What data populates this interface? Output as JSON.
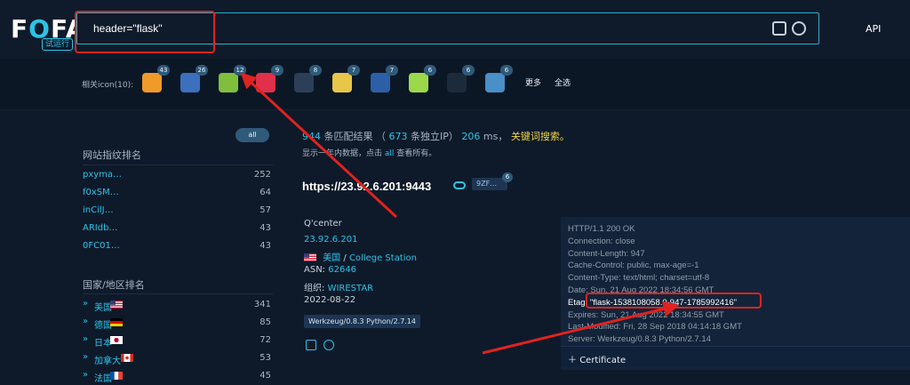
{
  "header": {
    "logo_text": "FOFA",
    "logo_badge": "试运行",
    "search_value": "header=\"flask\"",
    "api_label": "API"
  },
  "icon_bar": {
    "label": "相关icon(10):",
    "icons": [
      {
        "name": "icon-1",
        "count": "43",
        "color": "#f09a29"
      },
      {
        "name": "icon-2",
        "count": "26",
        "color": "#3d6fbf"
      },
      {
        "name": "icon-3",
        "count": "12",
        "color": "#7fbf3d"
      },
      {
        "name": "icon-4",
        "count": "9",
        "color": "#e0304a"
      },
      {
        "name": "icon-5",
        "count": "8",
        "color": "#2c3e58"
      },
      {
        "name": "icon-6",
        "count": "7",
        "color": "#e8c64a"
      },
      {
        "name": "icon-7",
        "count": "7",
        "color": "#2c5fa8"
      },
      {
        "name": "icon-8",
        "count": "6",
        "color": "#9bd84a"
      },
      {
        "name": "icon-9",
        "count": "6",
        "color": "#1b2b3c"
      },
      {
        "name": "icon-10",
        "count": "6",
        "color": "#4a8fc7"
      }
    ],
    "more_label": "更多",
    "select_all_label": "全选"
  },
  "fingerprint": {
    "title": "网站指纹排名",
    "all_label": "all",
    "items": [
      {
        "name": "pxyma…",
        "count": "252"
      },
      {
        "name": "f0xSM…",
        "count": "64"
      },
      {
        "name": "inCilJ…",
        "count": "57"
      },
      {
        "name": "ARIdb…",
        "count": "43"
      },
      {
        "name": "0FC01…",
        "count": "43"
      }
    ]
  },
  "countries": {
    "title": "国家/地区排名",
    "items": [
      {
        "name": "美国",
        "count": "341",
        "flag": "us"
      },
      {
        "name": "德国",
        "count": "85",
        "flag": "de"
      },
      {
        "name": "日本",
        "count": "72",
        "flag": "jp"
      },
      {
        "name": "加拿大",
        "count": "53",
        "flag": "ca"
      },
      {
        "name": "法国",
        "count": "45",
        "flag": "fr"
      }
    ]
  },
  "summary": {
    "total": "944",
    "total_suffix": "条匹配结果",
    "paren_open": "（",
    "unique_ip": "673",
    "unique_ip_suffix": "条独立IP）",
    "ms_value": "206",
    "ms_suffix": "ms，",
    "keyword_label": "关键词搜索。",
    "line2_prefix": "显示一年内数据，点击",
    "line2_all": "all",
    "line2_suffix": "查看所有。"
  },
  "result": {
    "host": "https://23.92.6.201:9443",
    "tag": "9ZF…",
    "tag_count": "6",
    "title": "Q'center",
    "ip": "23.92.6.201",
    "country": "美国",
    "separator": "/",
    "city": "College Station",
    "asn_label": "ASN:",
    "asn_value": "62646",
    "org_label": "组织:",
    "org_value": "WIRESTAR",
    "date": "2022-08-22",
    "server_tag": "Werkzeug/0.8.3 Python/2.7.14"
  },
  "response_headers": [
    "HTTP/1.1 200 OK",
    "Connection: close",
    "Content-Length: 947",
    "Cache-Control: public, max-age=-1",
    "Content-Type: text/html; charset=utf-8",
    "Date: Sun, 21 Aug 2022 18:34:56 GMT",
    "Etag: \"flask-1538108058.0-947-1785992416\"",
    "Expires: Sun, 21 Aug 2022 18:34:55 GMT",
    "Last-Modified: Fri, 28 Sep 2018 04:14:18 GMT",
    "Server: Werkzeug/0.8.3 Python/2.7.14"
  ],
  "certificate_label": "Certificate",
  "colors": {
    "accent": "#2dc3e8",
    "annotation_red": "#e0231e",
    "keyword_yellow": "#f0d64a",
    "background": "#0e1a2a"
  }
}
